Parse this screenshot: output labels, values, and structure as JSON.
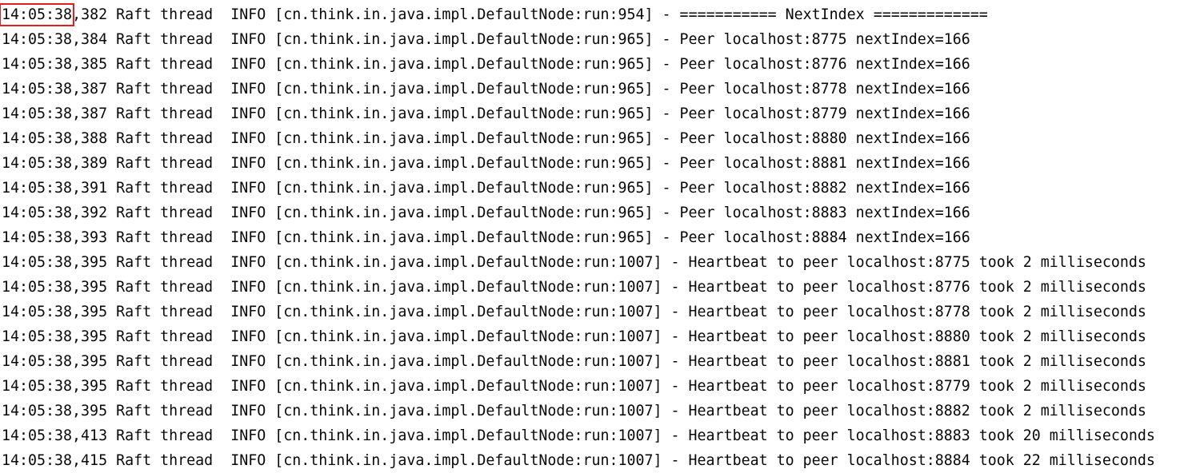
{
  "highlight": {
    "line_index": 0,
    "text": "14:05:38",
    "color": "#e02020"
  },
  "log_lines": [
    {
      "timestamp": "14:05:38,382",
      "thread": "Raft thread",
      "level": "INFO",
      "source": "[cn.think.in.java.impl.DefaultNode:run:954]",
      "message": "- =========== NextIndex ============="
    },
    {
      "timestamp": "14:05:38,384",
      "thread": "Raft thread",
      "level": "INFO",
      "source": "[cn.think.in.java.impl.DefaultNode:run:965]",
      "message": "- Peer localhost:8775 nextIndex=166"
    },
    {
      "timestamp": "14:05:38,385",
      "thread": "Raft thread",
      "level": "INFO",
      "source": "[cn.think.in.java.impl.DefaultNode:run:965]",
      "message": "- Peer localhost:8776 nextIndex=166"
    },
    {
      "timestamp": "14:05:38,387",
      "thread": "Raft thread",
      "level": "INFO",
      "source": "[cn.think.in.java.impl.DefaultNode:run:965]",
      "message": "- Peer localhost:8778 nextIndex=166"
    },
    {
      "timestamp": "14:05:38,387",
      "thread": "Raft thread",
      "level": "INFO",
      "source": "[cn.think.in.java.impl.DefaultNode:run:965]",
      "message": "- Peer localhost:8779 nextIndex=166"
    },
    {
      "timestamp": "14:05:38,388",
      "thread": "Raft thread",
      "level": "INFO",
      "source": "[cn.think.in.java.impl.DefaultNode:run:965]",
      "message": "- Peer localhost:8880 nextIndex=166"
    },
    {
      "timestamp": "14:05:38,389",
      "thread": "Raft thread",
      "level": "INFO",
      "source": "[cn.think.in.java.impl.DefaultNode:run:965]",
      "message": "- Peer localhost:8881 nextIndex=166"
    },
    {
      "timestamp": "14:05:38,391",
      "thread": "Raft thread",
      "level": "INFO",
      "source": "[cn.think.in.java.impl.DefaultNode:run:965]",
      "message": "- Peer localhost:8882 nextIndex=166"
    },
    {
      "timestamp": "14:05:38,392",
      "thread": "Raft thread",
      "level": "INFO",
      "source": "[cn.think.in.java.impl.DefaultNode:run:965]",
      "message": "- Peer localhost:8883 nextIndex=166"
    },
    {
      "timestamp": "14:05:38,393",
      "thread": "Raft thread",
      "level": "INFO",
      "source": "[cn.think.in.java.impl.DefaultNode:run:965]",
      "message": "- Peer localhost:8884 nextIndex=166"
    },
    {
      "timestamp": "14:05:38,395",
      "thread": "Raft thread",
      "level": "INFO",
      "source": "[cn.think.in.java.impl.DefaultNode:run:1007]",
      "message": "- Heartbeat to peer localhost:8775 took 2 milliseconds"
    },
    {
      "timestamp": "14:05:38,395",
      "thread": "Raft thread",
      "level": "INFO",
      "source": "[cn.think.in.java.impl.DefaultNode:run:1007]",
      "message": "- Heartbeat to peer localhost:8776 took 2 milliseconds"
    },
    {
      "timestamp": "14:05:38,395",
      "thread": "Raft thread",
      "level": "INFO",
      "source": "[cn.think.in.java.impl.DefaultNode:run:1007]",
      "message": "- Heartbeat to peer localhost:8778 took 2 milliseconds"
    },
    {
      "timestamp": "14:05:38,395",
      "thread": "Raft thread",
      "level": "INFO",
      "source": "[cn.think.in.java.impl.DefaultNode:run:1007]",
      "message": "- Heartbeat to peer localhost:8880 took 2 milliseconds"
    },
    {
      "timestamp": "14:05:38,395",
      "thread": "Raft thread",
      "level": "INFO",
      "source": "[cn.think.in.java.impl.DefaultNode:run:1007]",
      "message": "- Heartbeat to peer localhost:8881 took 2 milliseconds"
    },
    {
      "timestamp": "14:05:38,395",
      "thread": "Raft thread",
      "level": "INFO",
      "source": "[cn.think.in.java.impl.DefaultNode:run:1007]",
      "message": "- Heartbeat to peer localhost:8779 took 2 milliseconds"
    },
    {
      "timestamp": "14:05:38,395",
      "thread": "Raft thread",
      "level": "INFO",
      "source": "[cn.think.in.java.impl.DefaultNode:run:1007]",
      "message": "- Heartbeat to peer localhost:8882 took 2 milliseconds"
    },
    {
      "timestamp": "14:05:38,413",
      "thread": "Raft thread",
      "level": "INFO",
      "source": "[cn.think.in.java.impl.DefaultNode:run:1007]",
      "message": "- Heartbeat to peer localhost:8883 took 20 milliseconds"
    },
    {
      "timestamp": "14:05:38,415",
      "thread": "Raft thread",
      "level": "INFO",
      "source": "[cn.think.in.java.impl.DefaultNode:run:1007]",
      "message": "- Heartbeat to peer localhost:8884 took 22 milliseconds"
    }
  ]
}
